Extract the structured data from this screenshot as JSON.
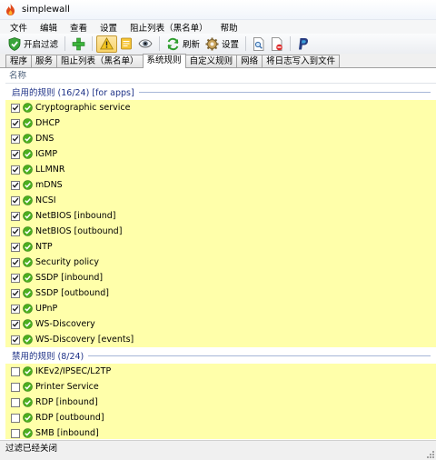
{
  "window": {
    "title": "simplewall"
  },
  "menu": [
    "文件",
    "编辑",
    "查看",
    "设置",
    "阻止列表（黑名单）",
    "帮助"
  ],
  "toolbar": {
    "enable_filters": "开启过滤",
    "refresh": "刷新",
    "settings": "设置"
  },
  "tabs": [
    "程序",
    "服务",
    "阻止列表（黑名单）",
    "系统规则",
    "自定义规则",
    "网络",
    "将日志写入到文件"
  ],
  "list": {
    "column_name": "名称",
    "enabled_group": {
      "title": "启用的规则 (16/24) [for apps]",
      "rules": [
        "Cryptographic service",
        "DHCP",
        "DNS",
        "IGMP",
        "LLMNR",
        "mDNS",
        "NCSI",
        "NetBIOS [inbound]",
        "NetBIOS [outbound]",
        "NTP",
        "Security policy",
        "SSDP [inbound]",
        "SSDP [outbound]",
        "UPnP",
        "WS-Discovery",
        "WS-Discovery [events]"
      ]
    },
    "disabled_group": {
      "title": "禁用的规则 (8/24)",
      "rules": [
        "IKEv2/IPSEC/L2TP",
        "Printer Service",
        "RDP [inbound]",
        "RDP [outbound]",
        "SMB [inbound]"
      ]
    }
  },
  "status": {
    "text": "过滤已经关闭"
  },
  "colors": {
    "row_highlight": "#ffffaa",
    "group_text": "#1e3287",
    "check_green": "#4caf1f"
  }
}
